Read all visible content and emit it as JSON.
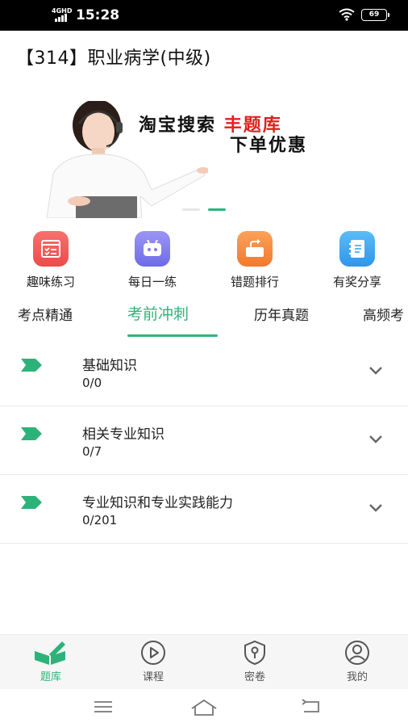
{
  "status_bar": {
    "network": "4GHD",
    "time": "15:28",
    "battery": "69",
    "icons": [
      "signal-icon",
      "wifi-icon",
      "battery-icon"
    ]
  },
  "header": {
    "title": "【314】职业病学(中级)"
  },
  "banner": {
    "line1_prefix": "淘宝搜索",
    "line1_highlight": "丰题库",
    "line2": "下单优惠",
    "slides": 2,
    "active_slide": 2
  },
  "quick_actions": [
    {
      "label": "趣味练习",
      "icon": "quiz-icon",
      "color": "#f05a5a"
    },
    {
      "label": "每日一练",
      "icon": "robot-icon",
      "color": "#7f7cf0"
    },
    {
      "label": "错题排行",
      "icon": "share-box-icon",
      "color": "#f5893a"
    },
    {
      "label": "有奖分享",
      "icon": "notebook-icon",
      "color": "#3aa5f2"
    }
  ],
  "tabs": [
    {
      "label": "考点精通",
      "active": false
    },
    {
      "label": "考前冲刺",
      "active": true
    },
    {
      "label": "历年真题",
      "active": false
    },
    {
      "label": "高频考",
      "active": false
    }
  ],
  "chapters": [
    {
      "title": "基础知识",
      "progress": "0/0"
    },
    {
      "title": "相关专业知识",
      "progress": "0/7"
    },
    {
      "title": "专业知识和专业实践能力",
      "progress": "0/201"
    }
  ],
  "bottom_nav": [
    {
      "label": "题库",
      "icon": "book-pen-icon",
      "active": true
    },
    {
      "label": "课程",
      "icon": "play-circle-icon",
      "active": false
    },
    {
      "label": "密卷",
      "icon": "secret-shield-icon",
      "active": false
    },
    {
      "label": "我的",
      "icon": "user-circle-icon",
      "active": false
    }
  ],
  "theme": {
    "accent": "#2db37a",
    "highlight_red": "#e02020"
  }
}
